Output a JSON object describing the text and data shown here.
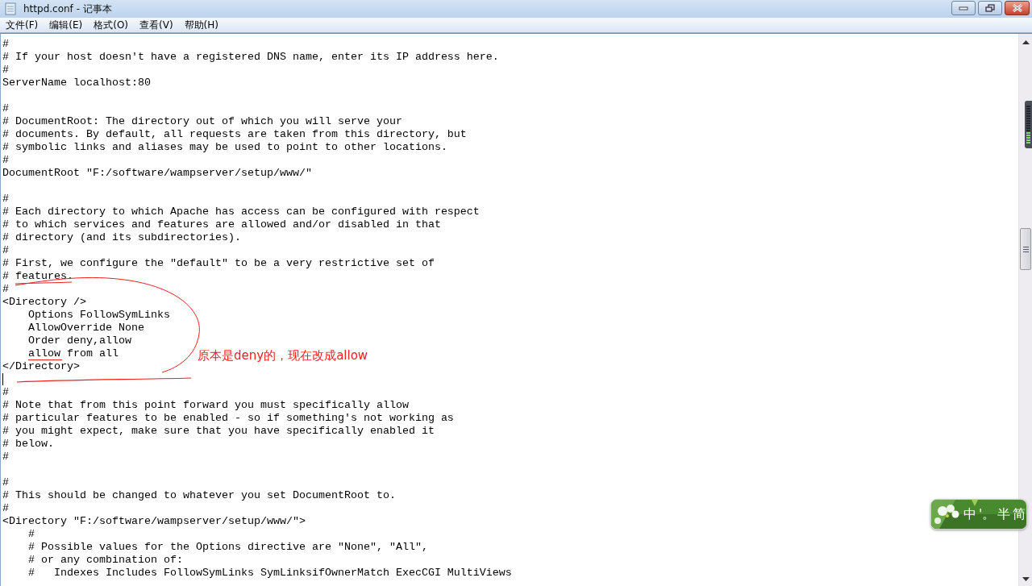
{
  "window": {
    "title": "httpd.conf - 记事本"
  },
  "menu": [
    {
      "label": "文件(F)"
    },
    {
      "label": "编辑(E)"
    },
    {
      "label": "格式(O)"
    },
    {
      "label": "查看(V)"
    },
    {
      "label": "帮助(H)"
    }
  ],
  "editor": {
    "lines": [
      {
        "kind": "text",
        "text": "#"
      },
      {
        "kind": "text",
        "text": "# If your host doesn't have a registered DNS name, enter its IP address here."
      },
      {
        "kind": "text",
        "text": "#"
      },
      {
        "kind": "text",
        "text": "ServerName localhost:80"
      },
      {
        "kind": "blank"
      },
      {
        "kind": "text",
        "text": "#"
      },
      {
        "kind": "text",
        "text": "# DocumentRoot: The directory out of which you will serve your"
      },
      {
        "kind": "text",
        "text": "# documents. By default, all requests are taken from this directory, but"
      },
      {
        "kind": "text",
        "text": "# symbolic links and aliases may be used to point to other locations."
      },
      {
        "kind": "text",
        "text": "#"
      },
      {
        "kind": "text",
        "text": "DocumentRoot \"F:/software/wampserver/setup/www/\""
      },
      {
        "kind": "blank"
      },
      {
        "kind": "text",
        "text": "#"
      },
      {
        "kind": "text",
        "text": "# Each directory to which Apache has access can be configured with respect"
      },
      {
        "kind": "text",
        "text": "# to which services and features are allowed and/or disabled in that"
      },
      {
        "kind": "text",
        "text": "# directory (and its subdirectories)."
      },
      {
        "kind": "text",
        "text": "#"
      },
      {
        "kind": "text",
        "text": "# First, we configure the \"default\" to be a very restrictive set of"
      },
      {
        "kind": "text",
        "text": "# features."
      },
      {
        "kind": "text",
        "text": "#"
      },
      {
        "kind": "text",
        "text": "<Directory />"
      },
      {
        "kind": "text",
        "text": "    Options FollowSymLinks"
      },
      {
        "kind": "text",
        "text": "    AllowOverride None"
      },
      {
        "kind": "text",
        "text": "    Order deny,allow"
      },
      {
        "kind": "text",
        "text": "    allow from all"
      },
      {
        "kind": "text",
        "text": "</Directory>"
      },
      {
        "kind": "caret"
      },
      {
        "kind": "text",
        "text": "#"
      },
      {
        "kind": "text",
        "text": "# Note that from this point forward you must specifically allow"
      },
      {
        "kind": "text",
        "text": "# particular features to be enabled - so if something's not working as"
      },
      {
        "kind": "text",
        "text": "# you might expect, make sure that you have specifically enabled it"
      },
      {
        "kind": "text",
        "text": "# below."
      },
      {
        "kind": "text",
        "text": "#"
      },
      {
        "kind": "blank"
      },
      {
        "kind": "text",
        "text": "#"
      },
      {
        "kind": "text",
        "text": "# This should be changed to whatever you set DocumentRoot to."
      },
      {
        "kind": "text",
        "text": "#"
      },
      {
        "kind": "text",
        "text": "<Directory \"F:/software/wampserver/setup/www/\">"
      },
      {
        "kind": "text",
        "text": "    #"
      },
      {
        "kind": "text",
        "text": "    # Possible values for the Options directive are \"None\", \"All\","
      },
      {
        "kind": "text",
        "text": "    # or any combination of:"
      },
      {
        "kind": "text",
        "text": "    #   Indexes Includes FollowSymLinks SymLinksifOwnerMatch ExecCGI MultiViews"
      }
    ]
  },
  "annotation": {
    "note": "原本是deny的，现在改成allow"
  },
  "ime_bar": {
    "items": [
      {
        "label": "中"
      },
      {
        "label": "'。"
      },
      {
        "label": "半"
      },
      {
        "label": "简"
      }
    ]
  }
}
